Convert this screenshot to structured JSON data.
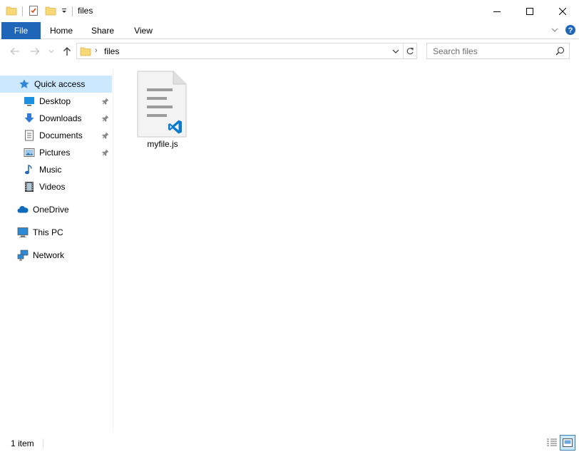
{
  "window": {
    "title": "files"
  },
  "ribbon": {
    "tabs": [
      "File",
      "Home",
      "Share",
      "View"
    ]
  },
  "address": {
    "path": "files"
  },
  "search": {
    "placeholder": "Search files"
  },
  "sidebar": {
    "quick_access": "Quick access",
    "pinned": [
      {
        "label": "Desktop",
        "icon": "desktop-icon"
      },
      {
        "label": "Downloads",
        "icon": "downloads-icon"
      },
      {
        "label": "Documents",
        "icon": "documents-icon"
      },
      {
        "label": "Pictures",
        "icon": "pictures-icon"
      }
    ],
    "unpinned": [
      {
        "label": "Music",
        "icon": "music-icon"
      },
      {
        "label": "Videos",
        "icon": "videos-icon"
      }
    ],
    "onedrive": "OneDrive",
    "this_pc": "This PC",
    "network": "Network"
  },
  "files": [
    {
      "name": "myfile.js",
      "icon": "vscode-js-file-icon"
    }
  ],
  "status": {
    "item_count": "1 item"
  },
  "colors": {
    "accent": "#1f66b9",
    "selection": "#cce8ff",
    "vscode_blue": "#0a7acc",
    "folder_yellow": "#f8d775"
  }
}
